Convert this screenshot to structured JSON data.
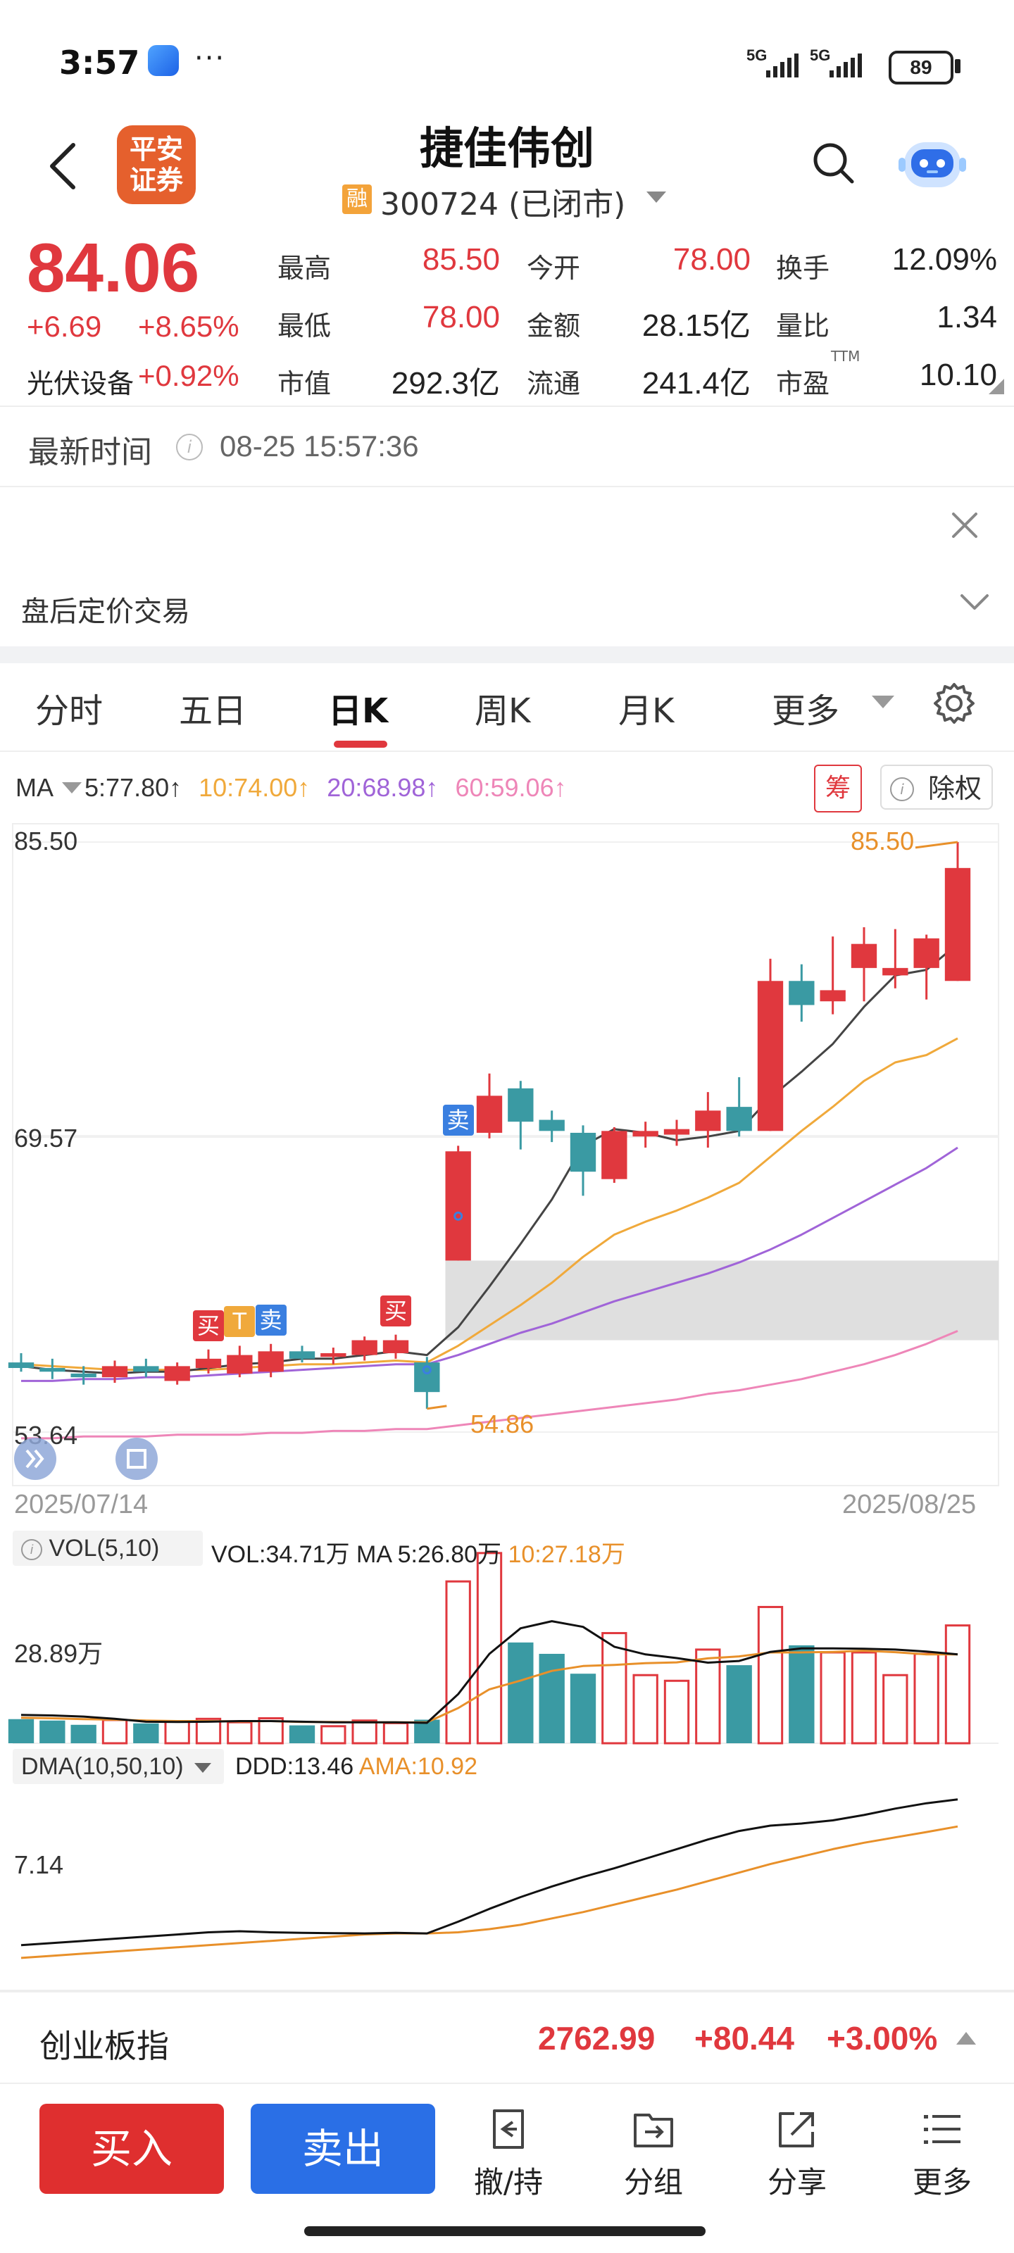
{
  "status_bar": {
    "time": "3:57",
    "dots": "···",
    "signal_1": "5G",
    "signal_2": "5G",
    "battery": "89"
  },
  "header": {
    "broker_logo_line1": "平安",
    "broker_logo_line2": "证券",
    "title": "捷佳伟创",
    "margin_badge": "融",
    "code_status": "300724 (已闭市)"
  },
  "quote": {
    "price": "84.06",
    "change": "+6.69",
    "change_pct": "+8.65%",
    "sector": "光伏设备",
    "sector_pct": "+0.92%",
    "grid": [
      {
        "label": "最高",
        "value": "85.50",
        "color": "#e0383e"
      },
      {
        "label": "今开",
        "value": "78.00",
        "color": "#e0383e"
      },
      {
        "label": "换手",
        "value": "12.09%",
        "color": "#222222"
      },
      {
        "label": "最低",
        "value": "78.00",
        "color": "#e0383e"
      },
      {
        "label": "金额",
        "value": "28.15亿",
        "color": "#222222"
      },
      {
        "label": "量比",
        "value": "1.34",
        "color": "#222222"
      },
      {
        "label": "市值",
        "value": "292.3亿",
        "color": "#222222"
      },
      {
        "label": "流通",
        "value": "241.4亿",
        "color": "#222222"
      },
      {
        "label": "市盈",
        "value": "10.10",
        "color": "#222222"
      }
    ],
    "pe_superscript": "TTM"
  },
  "latest_time": {
    "label": "最新时间",
    "info_icon": "i",
    "value": "08-25 15:57:36"
  },
  "after_hours": {
    "label": "盘后定价交易"
  },
  "tabs": [
    {
      "label": "分时",
      "active": false
    },
    {
      "label": "五日",
      "active": false
    },
    {
      "label": "日K",
      "active": true
    },
    {
      "label": "周K",
      "active": false
    },
    {
      "label": "月K",
      "active": false
    },
    {
      "label": "更多",
      "active": false
    }
  ],
  "ma_row": {
    "label": "MA",
    "ma5": "5:77.80↑",
    "ma10": "10:74.00↑",
    "ma20": "20:68.98↑",
    "ma60": "60:59.06↑",
    "chip_btn": "筹",
    "adjust_btn": "除权",
    "adjust_icon": "i",
    "colors": {
      "ma5": "#333333",
      "ma10": "#f0a93b",
      "ma20": "#a064d8",
      "ma60": "#ee86b8"
    }
  },
  "chart_data": {
    "type": "candlestick",
    "price_axis_labels": [
      "85.50",
      "69.57",
      "53.64"
    ],
    "ylim": [
      53.64,
      85.5
    ],
    "x_start": "2025/07/14",
    "x_end": "2025/08/25",
    "high_annotation": "85.50",
    "low_annotation": "54.86",
    "candles": [
      {
        "o": 57.4,
        "h": 57.9,
        "l": 56.9,
        "c": 57.1
      },
      {
        "o": 57.1,
        "h": 57.6,
        "l": 56.5,
        "c": 56.9
      },
      {
        "o": 56.8,
        "h": 57.2,
        "l": 56.2,
        "c": 56.6
      },
      {
        "o": 56.6,
        "h": 57.5,
        "l": 56.3,
        "c": 57.2
      },
      {
        "o": 57.2,
        "h": 57.6,
        "l": 56.6,
        "c": 56.9
      },
      {
        "o": 56.4,
        "h": 57.4,
        "l": 56.2,
        "c": 57.2
      },
      {
        "o": 57.1,
        "h": 58.1,
        "l": 56.8,
        "c": 57.6
      },
      {
        "o": 56.8,
        "h": 58.3,
        "l": 56.6,
        "c": 57.8
      },
      {
        "o": 56.9,
        "h": 58.4,
        "l": 56.6,
        "c": 58.0
      },
      {
        "o": 58.0,
        "h": 58.3,
        "l": 57.4,
        "c": 57.6
      },
      {
        "o": 57.7,
        "h": 58.2,
        "l": 57.3,
        "c": 57.9
      },
      {
        "o": 57.8,
        "h": 58.8,
        "l": 57.5,
        "c": 58.6
      },
      {
        "o": 57.9,
        "h": 58.9,
        "l": 57.6,
        "c": 58.6
      },
      {
        "o": 57.4,
        "h": 57.7,
        "l": 54.9,
        "c": 55.8
      },
      {
        "o": 62.9,
        "h": 69.1,
        "l": 62.9,
        "c": 68.8
      },
      {
        "o": 69.8,
        "h": 73.0,
        "l": 69.5,
        "c": 71.8
      },
      {
        "o": 72.2,
        "h": 72.6,
        "l": 68.9,
        "c": 70.4
      },
      {
        "o": 70.5,
        "h": 71.0,
        "l": 69.3,
        "c": 69.9
      },
      {
        "o": 69.8,
        "h": 70.2,
        "l": 66.4,
        "c": 67.7
      },
      {
        "o": 67.3,
        "h": 70.1,
        "l": 67.1,
        "c": 69.9
      },
      {
        "o": 69.6,
        "h": 70.4,
        "l": 69.0,
        "c": 69.9
      },
      {
        "o": 69.7,
        "h": 70.5,
        "l": 69.1,
        "c": 70.0
      },
      {
        "o": 69.9,
        "h": 72.0,
        "l": 69.0,
        "c": 71.0
      },
      {
        "o": 71.2,
        "h": 72.8,
        "l": 69.6,
        "c": 69.9
      },
      {
        "o": 69.9,
        "h": 79.2,
        "l": 69.9,
        "c": 78.0
      },
      {
        "o": 78.0,
        "h": 78.9,
        "l": 75.8,
        "c": 76.7
      },
      {
        "o": 76.9,
        "h": 80.4,
        "l": 76.2,
        "c": 77.5
      },
      {
        "o": 78.7,
        "h": 80.9,
        "l": 76.9,
        "c": 80.0
      },
      {
        "o": 78.3,
        "h": 80.8,
        "l": 77.6,
        "c": 78.7
      },
      {
        "o": 78.7,
        "h": 80.5,
        "l": 77.0,
        "c": 80.3
      },
      {
        "o": 78.0,
        "h": 85.5,
        "l": 78.0,
        "c": 84.1
      }
    ],
    "ma5": [
      57.2,
      57.0,
      56.9,
      56.8,
      56.9,
      56.9,
      57.1,
      57.3,
      57.4,
      57.6,
      57.6,
      57.8,
      58.0,
      57.8,
      59.3,
      61.5,
      63.8,
      66.2,
      69.1,
      70.0,
      69.8,
      69.4,
      69.6,
      69.9,
      71.7,
      73.1,
      74.6,
      76.6,
      78.3,
      78.6,
      80.0
    ],
    "ma10": [
      57.3,
      57.2,
      57.1,
      57.0,
      57.0,
      57.0,
      57.0,
      57.1,
      57.2,
      57.3,
      57.3,
      57.4,
      57.5,
      57.4,
      58.3,
      59.4,
      60.5,
      61.7,
      63.1,
      64.3,
      65.0,
      65.6,
      66.3,
      67.1,
      68.5,
      69.9,
      71.2,
      72.6,
      73.6,
      74.0,
      74.9
    ],
    "ma20": [
      56.4,
      56.4,
      56.5,
      56.5,
      56.6,
      56.6,
      56.7,
      56.8,
      56.9,
      57.0,
      57.1,
      57.2,
      57.3,
      57.3,
      57.8,
      58.4,
      59.0,
      59.5,
      60.1,
      60.7,
      61.2,
      61.7,
      62.2,
      62.8,
      63.5,
      64.3,
      65.2,
      66.1,
      67.0,
      67.9,
      69.0
    ],
    "ma60": [
      53.3,
      53.3,
      53.4,
      53.4,
      53.4,
      53.5,
      53.5,
      53.5,
      53.6,
      53.6,
      53.7,
      53.7,
      53.8,
      53.8,
      54.0,
      54.2,
      54.4,
      54.6,
      54.8,
      55.0,
      55.2,
      55.4,
      55.7,
      55.9,
      56.2,
      56.5,
      56.9,
      57.3,
      57.8,
      58.4,
      59.1
    ],
    "signals": [
      {
        "text": "买",
        "index": 6,
        "color": "#e0383e"
      },
      {
        "text": "T",
        "index": 7,
        "color": "#f0a93b"
      },
      {
        "text": "卖",
        "index": 8,
        "color": "#3a7fe0"
      },
      {
        "text": "买",
        "index": 12,
        "color": "#e0383e"
      },
      {
        "text": "卖",
        "index": 14,
        "color": "#3a7fe0"
      }
    ],
    "volume": {
      "label": "VOL(5,10)",
      "vol_text": "VOL:34.71万",
      "ma5_text": "MA 5:26.80万",
      "ma10_text": "10:27.18万",
      "axis_label": "28.89万",
      "ylim": [
        0,
        62
      ],
      "values": [
        8.5,
        8.0,
        6.5,
        8.2,
        7.0,
        7.8,
        8.6,
        7.4,
        8.8,
        6.3,
        6.0,
        8.0,
        7.1,
        8.3,
        57.0,
        67.0,
        35.5,
        31.5,
        24.5,
        38.8,
        24.0,
        22.0,
        33.0,
        27.5,
        48.0,
        34.5,
        32.0,
        32.0,
        24.0,
        31.5,
        41.5
      ],
      "ma5": [
        10.0,
        9.8,
        9.4,
        8.6,
        7.6,
        7.5,
        7.6,
        7.8,
        7.8,
        7.6,
        7.4,
        7.4,
        7.4,
        7.2,
        17.3,
        31.5,
        40.5,
        43.0,
        41.0,
        34.0,
        31.3,
        30.0,
        28.4,
        29.0,
        32.2,
        33.4,
        33.4,
        33.3,
        33.0,
        32.3,
        31.3
      ],
      "ma10": [
        9.0,
        8.8,
        8.5,
        8.3,
        8.0,
        7.8,
        7.8,
        7.7,
        7.8,
        7.5,
        7.5,
        7.4,
        7.4,
        7.4,
        12.4,
        19.0,
        22.1,
        25.5,
        27.2,
        27.6,
        28.2,
        28.5,
        29.9,
        30.6,
        32.0,
        32.0,
        32.2,
        32.6,
        32.1,
        31.3,
        31.3
      ]
    },
    "dma": {
      "label": "DMA(10,50,10)",
      "ddd_text": "DDD:13.46",
      "ama_text": "AMA:10.92",
      "axis_label": "7.14",
      "ylim": [
        -2,
        14.5
      ],
      "ddd": [
        -0.2,
        0.0,
        0.2,
        0.4,
        0.6,
        0.8,
        1.0,
        1.1,
        1.0,
        0.95,
        0.92,
        0.9,
        0.95,
        0.9,
        2.0,
        3.2,
        4.3,
        5.3,
        6.2,
        7.0,
        7.9,
        8.8,
        9.7,
        10.5,
        11.0,
        11.2,
        11.5,
        12.0,
        12.6,
        13.1,
        13.46
      ],
      "ama": [
        -1.4,
        -1.2,
        -1.0,
        -0.8,
        -0.6,
        -0.4,
        -0.2,
        0.0,
        0.2,
        0.4,
        0.6,
        0.8,
        0.9,
        0.9,
        1.0,
        1.3,
        1.7,
        2.3,
        2.9,
        3.6,
        4.3,
        5.0,
        5.8,
        6.6,
        7.4,
        8.1,
        8.8,
        9.4,
        9.9,
        10.4,
        10.92
      ]
    }
  },
  "index_bar": {
    "name": "创业板指",
    "value": "2762.99",
    "change": "+80.44",
    "pct": "+3.00%"
  },
  "toolbar": {
    "buy": "买入",
    "sell": "卖出",
    "items": [
      {
        "label": "撤/持"
      },
      {
        "label": "分组"
      },
      {
        "label": "分享"
      },
      {
        "label": "更多"
      }
    ]
  }
}
